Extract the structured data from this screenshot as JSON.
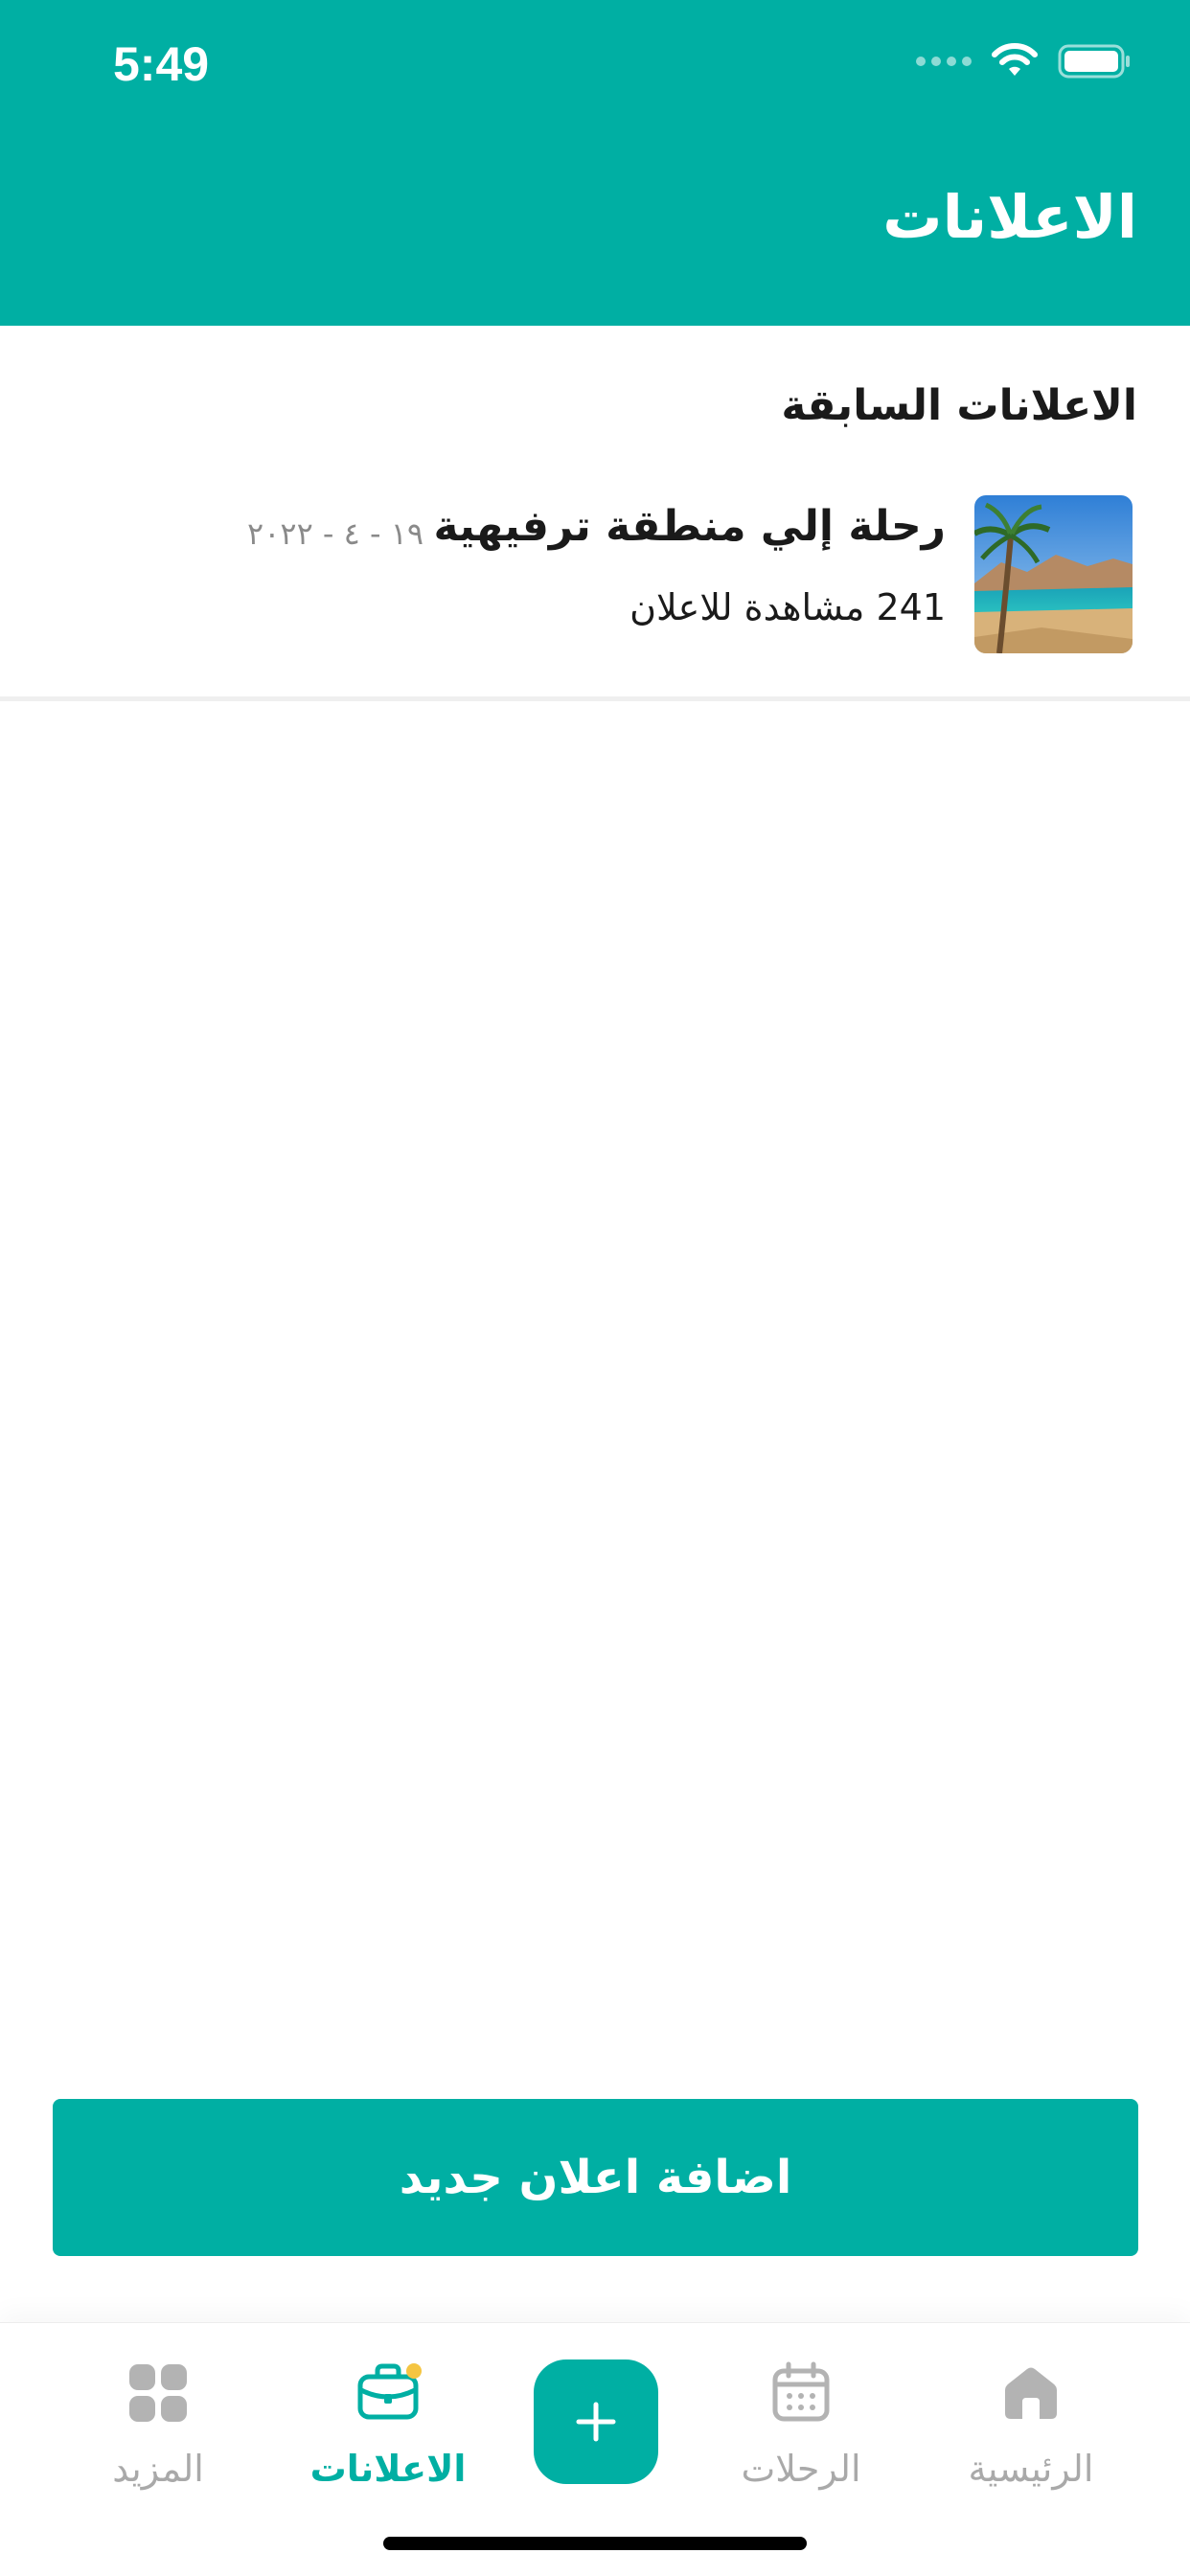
{
  "status_bar": {
    "time": "5:49"
  },
  "header": {
    "title": "الاعلانات"
  },
  "section": {
    "title": "الاعلانات السابقة"
  },
  "ads": [
    {
      "title": "رحلة إلي منطقة ترفيهية",
      "date": "١٩ - ٤ - ٢٠٢٢",
      "views": "241 مشاهدة للاعلان",
      "image": "beach-palm-image"
    }
  ],
  "add_button": {
    "label": "اضافة اعلان جديد"
  },
  "tabbar": {
    "items": [
      {
        "label": "الرئيسية",
        "icon": "home-icon",
        "active": false
      },
      {
        "label": "الرحلات",
        "icon": "calendar-icon",
        "active": false
      },
      {
        "label": "",
        "icon": "plus-icon",
        "active": false
      },
      {
        "label": "الاعلانات",
        "icon": "briefcase-icon",
        "active": true
      },
      {
        "label": "المزيد",
        "icon": "grid-icon",
        "active": false
      }
    ]
  },
  "colors": {
    "accent": "#00AFA3",
    "inactive": "#A9A9A9",
    "badge": "#F5C542"
  }
}
